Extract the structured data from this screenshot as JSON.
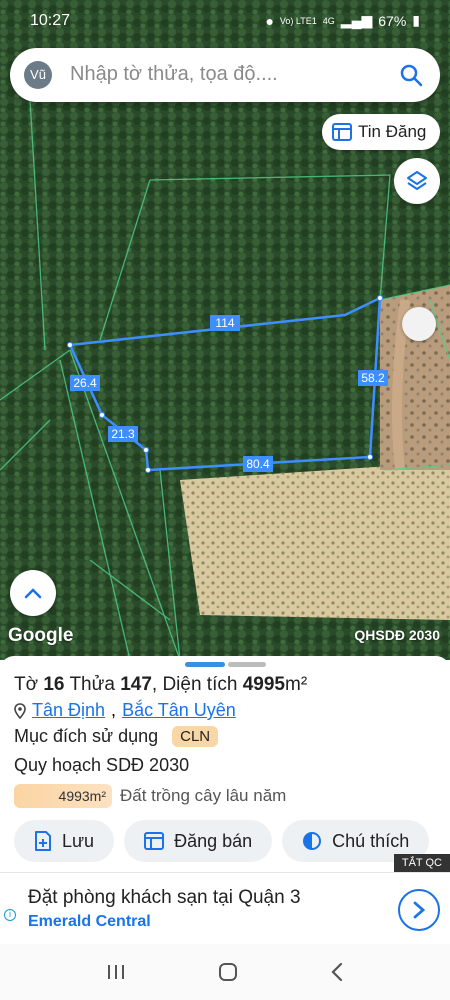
{
  "status": {
    "time": "10:27",
    "network": "Vo) LTE1",
    "signal": "4G",
    "battery": "67%"
  },
  "search": {
    "avatar": "Vũ",
    "placeholder": "Nhập tờ thửa, tọa độ...."
  },
  "map": {
    "tin_dang_label": "Tin Đăng",
    "google_label": "Google",
    "plan_label": "QHSDĐ 2030",
    "edges": [
      "114",
      "58.2",
      "80.4",
      "21.3",
      "26.4"
    ]
  },
  "parcel": {
    "to_label": "Tờ",
    "to_value": "16",
    "thua_label": "Thửa",
    "thua_value": "147",
    "dien_tich_label": "Diện tích",
    "dien_tich_value": "4995",
    "unit": "m²",
    "ward": "Tân Định",
    "district": "Bắc Tân Uyên",
    "muc_dich_label": "Mục đích sử dụng",
    "muc_dich_code": "CLN",
    "quy_hoach_label": "Quy hoạch SDĐ 2030",
    "plan_area": "4993m²",
    "plan_type": "Đất trồng cây lâu năm"
  },
  "actions": {
    "save": "Lưu",
    "post": "Đăng bán",
    "note": "Chú thích"
  },
  "ad": {
    "close_label": "TẮT QC",
    "title": "Đặt phòng khách sạn tại Quận 3",
    "brand": "Emerald Central"
  }
}
